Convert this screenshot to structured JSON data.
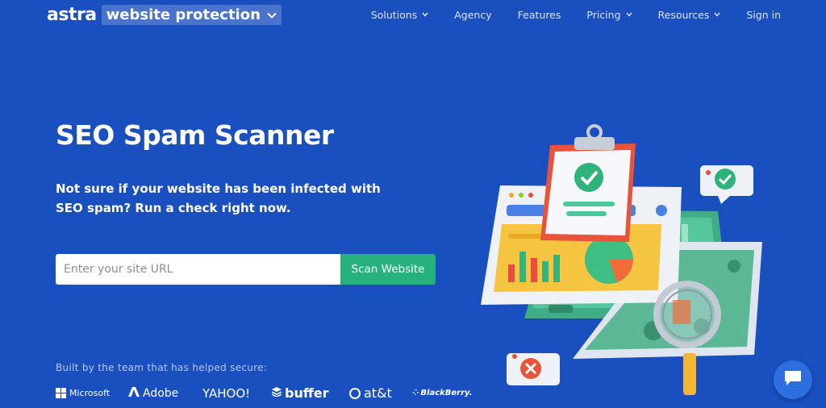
{
  "brand": {
    "name": "astra",
    "product": "website protection"
  },
  "nav": {
    "items": [
      {
        "label": "Solutions",
        "has_dropdown": true
      },
      {
        "label": "Agency",
        "has_dropdown": false
      },
      {
        "label": "Features",
        "has_dropdown": false
      },
      {
        "label": "Pricing",
        "has_dropdown": true
      },
      {
        "label": "Resources",
        "has_dropdown": true
      },
      {
        "label": "Sign in",
        "has_dropdown": false
      }
    ]
  },
  "hero": {
    "title": "SEO Spam Scanner",
    "subtitle": "Not sure if your website has been infected with SEO spam? Run a check right now.",
    "input_placeholder": "Enter your site URL",
    "input_value": "",
    "button_label": "Scan Website"
  },
  "trust": {
    "text": "Built by the team that has helped secure:",
    "logos": [
      "Microsoft",
      "Adobe",
      "YAHOO!",
      "buffer",
      "at&t",
      "BlackBerry."
    ]
  },
  "colors": {
    "background": "#1a4fbf",
    "accent_green": "#27b27d",
    "brand_chip": "#4a73cc",
    "chat_button": "#2d6fe0"
  },
  "icons": {
    "brand_dropdown": "chevron-down-icon",
    "chat": "chat-bubble-icon"
  }
}
